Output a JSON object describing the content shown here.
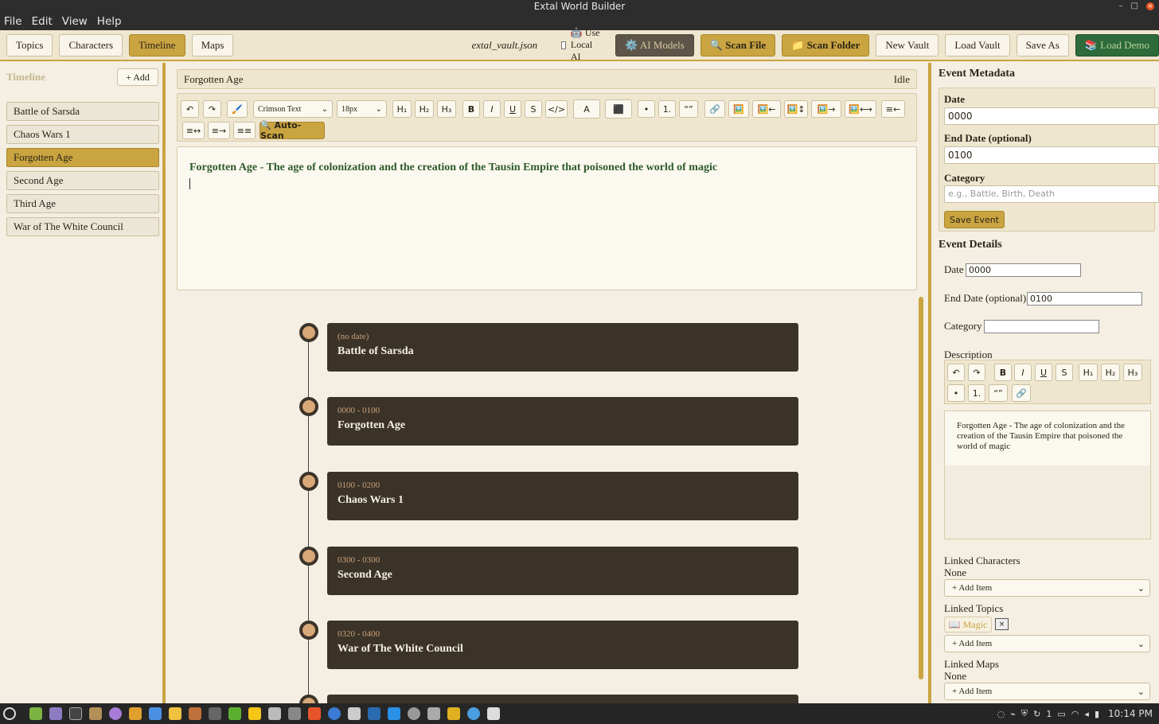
{
  "window": {
    "title": "Extal World Builder"
  },
  "menu": [
    "File",
    "Edit",
    "View",
    "Help"
  ],
  "toolbar": {
    "tabs": [
      "Topics",
      "Characters",
      "Timeline",
      "Maps"
    ],
    "active_tab": "Timeline",
    "vault_file": "extal_vault.json",
    "use_local_ai_label": "🤖 Use Local AI",
    "use_local_ai_checked": false,
    "ai_models": "⚙️ AI Models",
    "scan_file": "🔍 Scan File",
    "scan_folder": "📁 Scan Folder",
    "new_vault": "New Vault",
    "load_vault": "Load Vault",
    "save_as": "Save As",
    "load_demo": "📚 Load Demo"
  },
  "sidebar": {
    "title": "Timeline",
    "add_label": "+ Add",
    "items": [
      {
        "label": "Battle of Sarsda"
      },
      {
        "label": "Chaos Wars 1"
      },
      {
        "label": "Forgotten Age"
      },
      {
        "label": "Second Age"
      },
      {
        "label": "Third Age"
      },
      {
        "label": "War of The White Council"
      }
    ],
    "selected": "Forgotten Age"
  },
  "editor": {
    "doc_title": "Forgotten Age",
    "status": "Idle",
    "font": "Crimson Text",
    "size": "18px",
    "toolbar_labels": {
      "undo": "↶",
      "redo": "↷",
      "brush": "🖌️",
      "h1": "H₁",
      "h2": "H₂",
      "h3": "H₃",
      "bold": "B",
      "italic": "I",
      "underline": "U",
      "strike": "S",
      "code": "</>",
      "text_color": "A",
      "bg_color": "⬛",
      "bullet": "•",
      "numbered": "1.",
      "quote": "“”",
      "link": "🔗",
      "image": "🖼️",
      "img_left": "🖼️←",
      "img_inline": "🖼️↕",
      "img_right": "🖼️→",
      "img_full": "🖼️⟷",
      "align_left": "≡←",
      "align_center": "≡↔",
      "align_right": "≡→",
      "justify": "≡≡",
      "auto_scan": "🔍 Auto-Scan"
    },
    "content": "Forgotten Age - The age of colonization and the creation of the Tausin Empire that poisoned the world of magic"
  },
  "timeline": {
    "events": [
      {
        "date": "(no date)",
        "title": "Battle of Sarsda"
      },
      {
        "date": "0000 - 0100",
        "title": "Forgotten Age"
      },
      {
        "date": "0100 - 0200",
        "title": "Chaos Wars 1"
      },
      {
        "date": "0300 - 0300",
        "title": "Second Age"
      },
      {
        "date": "0320 - 0400",
        "title": "War of The White Council"
      },
      {
        "date": "",
        "title": ""
      }
    ]
  },
  "metadata": {
    "heading": "Event Metadata",
    "date_label": "Date",
    "date_value": "0000",
    "end_label": "End Date (optional)",
    "end_value": "0100",
    "category_label": "Category",
    "category_placeholder": "e.g., Battle, Birth, Death",
    "save_label": "Save Event"
  },
  "details": {
    "heading": "Event Details",
    "date_label": "Date",
    "date_value": "0000",
    "end_label": "End Date (optional)",
    "end_value": "0100",
    "category_label": "Category",
    "category_value": "",
    "description_label": "Description",
    "desc_toolbar": {
      "undo": "↶",
      "redo": "↷",
      "bold": "B",
      "italic": "I",
      "underline": "U",
      "strike": "S",
      "h1": "H₁",
      "h2": "H₂",
      "h3": "H₃",
      "bullet": "•",
      "numbered": "1.",
      "quote": "“”",
      "link": "🔗"
    },
    "description": "Forgotten Age - The age of colonization and the creation of the Tausin Empire that poisoned the world of magic",
    "linked_characters_label": "Linked Characters",
    "linked_characters_value": "None",
    "linked_topics_label": "Linked Topics",
    "linked_topic_tag": "📖 Magic",
    "remove_tag": "×",
    "linked_maps_label": "Linked Maps",
    "linked_maps_value": "None",
    "add_item": "+ Add Item"
  },
  "tray": {
    "tray_indicator": "1",
    "clock": "10:14 PM"
  },
  "colors": {
    "accent": "#c9a440",
    "card": "#3b3328",
    "panel": "#f4efe2",
    "heading_green": "#2e5b2a"
  }
}
